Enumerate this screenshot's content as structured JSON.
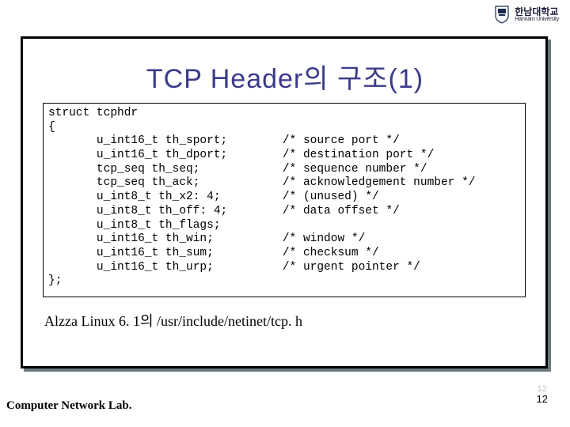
{
  "logo": {
    "korean": "한남대학교",
    "english": "Hannam University"
  },
  "title": "TCP Header의 구조(1)",
  "code": "struct tcphdr\n{\n       u_int16_t th_sport;        /* source port */\n       u_int16_t th_dport;        /* destination port */\n       tcp_seq th_seq;            /* sequence number */\n       tcp_seq th_ack;            /* acknowledgement number */\n       u_int8_t th_x2: 4;         /* (unused) */\n       u_int8_t th_off: 4;        /* data offset */\n       u_int8_t th_flags;\n       u_int16_t th_win;          /* window */\n       u_int16_t th_sum;          /* checksum */\n       u_int16_t th_urp;          /* urgent pointer */\n};",
  "caption": "Alzza Linux 6. 1의 /usr/include/netinet/tcp. h",
  "footer": "Computer Network Lab.",
  "page": {
    "faded": "12",
    "main": "12"
  }
}
